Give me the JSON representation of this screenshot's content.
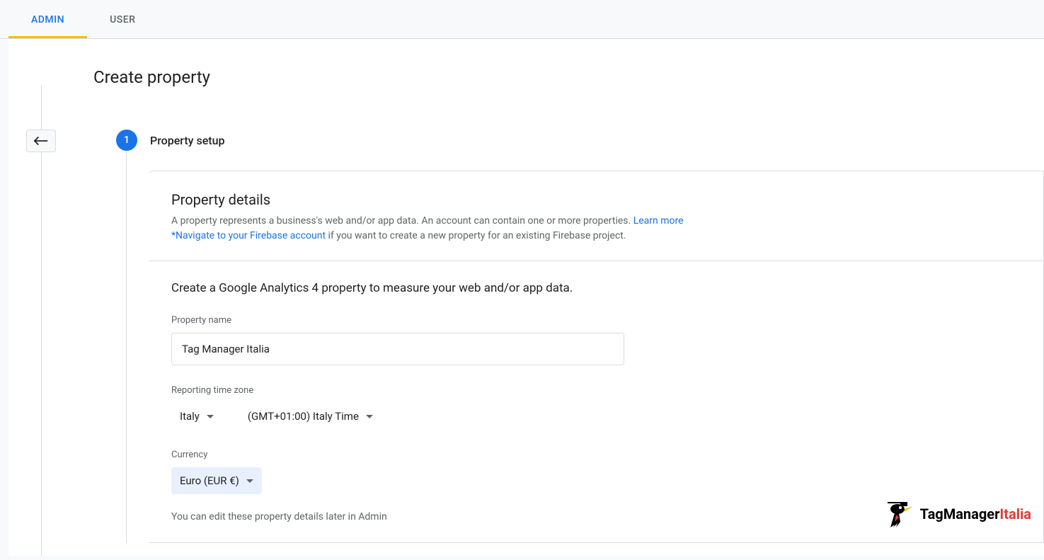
{
  "tabs": {
    "admin": "ADMIN",
    "user": "USER"
  },
  "page_title": "Create property",
  "step": {
    "number": "1",
    "title": "Property setup"
  },
  "property_details": {
    "heading": "Property details",
    "description_prefix": "A property represents a business's web and/or app data. An account can contain one or more properties. ",
    "learn_more": "Learn more",
    "firebase_link": "*Navigate to your Firebase account",
    "firebase_suffix": " if you want to create a new property for an existing Firebase project."
  },
  "form": {
    "intro": "Create a Google Analytics 4 property to measure your web and/or app data.",
    "property_name_label": "Property name",
    "property_name_value": "Tag Manager Italia",
    "timezone_label": "Reporting time zone",
    "timezone_country": "Italy",
    "timezone_value": "(GMT+01:00) Italy Time",
    "currency_label": "Currency",
    "currency_value": "Euro (EUR €)",
    "helper": "You can edit these property details later in Admin"
  },
  "watermark": {
    "prefix": "TagManager",
    "suffix": "Italia"
  }
}
